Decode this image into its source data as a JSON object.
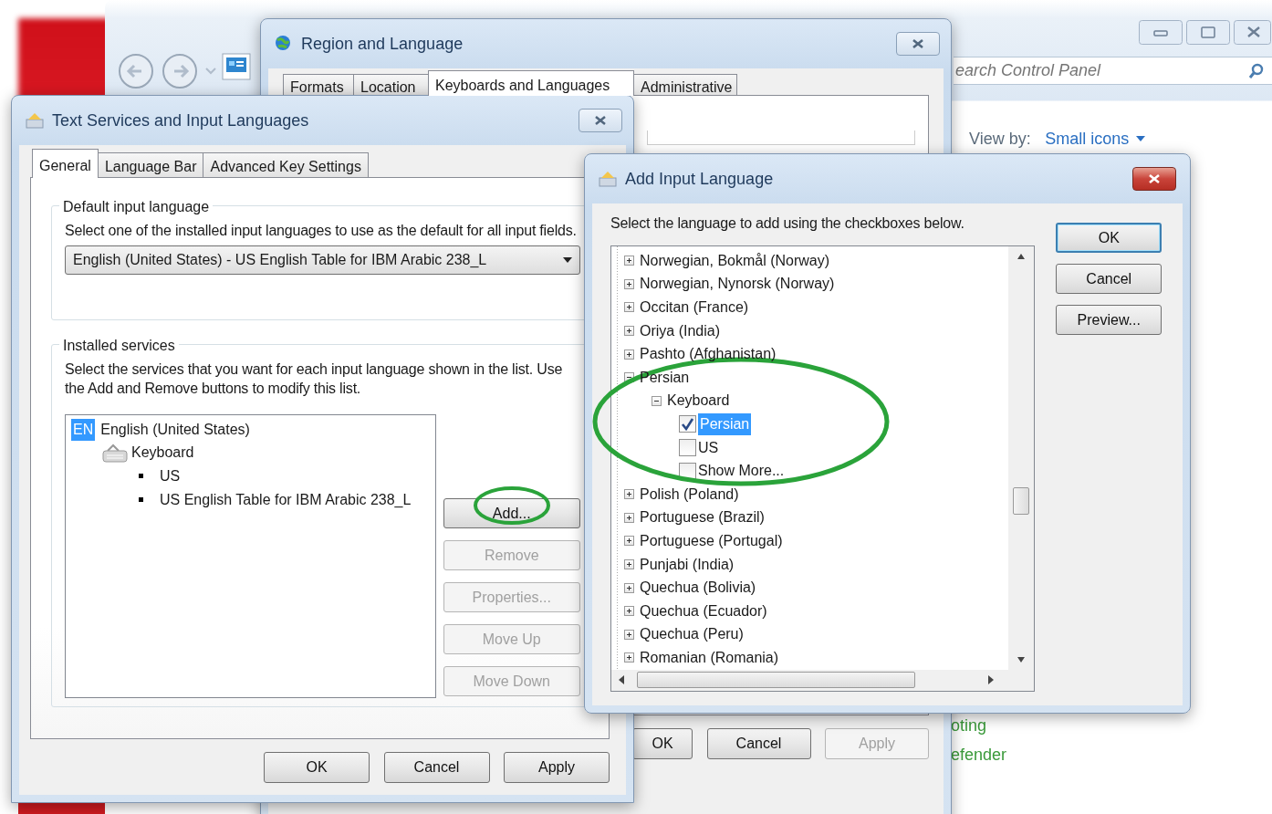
{
  "control_panel": {
    "search": {
      "placeholder": "earch Control Panel"
    },
    "view_by_label": "View by:",
    "view_by_value": "Small icons",
    "links": [
      "oting",
      "efender"
    ]
  },
  "region_window": {
    "title": "Region and Language",
    "tabs": [
      {
        "label": "Formats",
        "selected": false
      },
      {
        "label": "Location",
        "selected": false
      },
      {
        "label": "Keyboards and Languages",
        "selected": true
      },
      {
        "label": "Administrative",
        "selected": false
      }
    ],
    "buttons": [
      {
        "label": "OK",
        "disabled": false
      },
      {
        "label": "Cancel",
        "disabled": false
      },
      {
        "label": "Apply",
        "disabled": true
      }
    ]
  },
  "text_services": {
    "title": "Text Services and Input Languages",
    "tabs": [
      {
        "label": "General",
        "selected": true
      },
      {
        "label": "Language Bar",
        "selected": false
      },
      {
        "label": "Advanced Key Settings",
        "selected": false
      }
    ],
    "default_group": {
      "title": "Default input language",
      "description": "Select one of the installed input languages to use as the default for all input fields.",
      "combo_value": "English (United States) - US English Table for IBM Arabic 238_L"
    },
    "services_group": {
      "title": "Installed services",
      "description": "Select the services that you want for each input language shown in the list. Use the Add and Remove buttons to modify this list.",
      "languages": [
        {
          "code": "EN",
          "name": "English (United States)",
          "selected": true,
          "children": [
            {
              "label": "Keyboard",
              "children": [
                {
                  "label": "US"
                },
                {
                  "label": "US English Table for IBM Arabic 238_L"
                }
              ]
            }
          ]
        }
      ],
      "buttons": [
        {
          "label": "Add...",
          "disabled": false
        },
        {
          "label": "Remove",
          "disabled": true
        },
        {
          "label": "Properties...",
          "disabled": true
        },
        {
          "label": "Move Up",
          "disabled": true
        },
        {
          "label": "Move Down",
          "disabled": true
        }
      ]
    },
    "buttons": [
      {
        "label": "OK",
        "disabled": false
      },
      {
        "label": "Cancel",
        "disabled": false
      },
      {
        "label": "Apply",
        "disabled": false
      }
    ]
  },
  "add_language": {
    "title": "Add Input Language",
    "instruction": "Select the language to add using the checkboxes below.",
    "tree": [
      {
        "label": "Norwegian, Bokmål (Norway)",
        "expanded": false
      },
      {
        "label": "Norwegian, Nynorsk (Norway)",
        "expanded": false
      },
      {
        "label": "Occitan (France)",
        "expanded": false
      },
      {
        "label": "Oriya (India)",
        "expanded": false
      },
      {
        "label": "Pashto (Afghanistan)",
        "expanded": false
      },
      {
        "label": "Persian",
        "expanded": true,
        "children": [
          {
            "label": "Keyboard",
            "expanded": true,
            "children": [
              {
                "label": "Persian",
                "checked": true,
                "selected": true
              },
              {
                "label": "US",
                "checked": false,
                "selected": false
              },
              {
                "label": "Show More...",
                "checked": false,
                "selected": false
              }
            ]
          }
        ]
      },
      {
        "label": "Polish (Poland)",
        "expanded": false
      },
      {
        "label": "Portuguese (Brazil)",
        "expanded": false
      },
      {
        "label": "Portuguese (Portugal)",
        "expanded": false
      },
      {
        "label": "Punjabi (India)",
        "expanded": false
      },
      {
        "label": "Quechua (Bolivia)",
        "expanded": false
      },
      {
        "label": "Quechua (Ecuador)",
        "expanded": false
      },
      {
        "label": "Quechua (Peru)",
        "expanded": false
      },
      {
        "label": "Romanian (Romania)",
        "expanded": false
      }
    ],
    "buttons": [
      {
        "label": "OK",
        "default": true
      },
      {
        "label": "Cancel",
        "default": false
      },
      {
        "label": "Preview...",
        "default": false
      }
    ]
  }
}
